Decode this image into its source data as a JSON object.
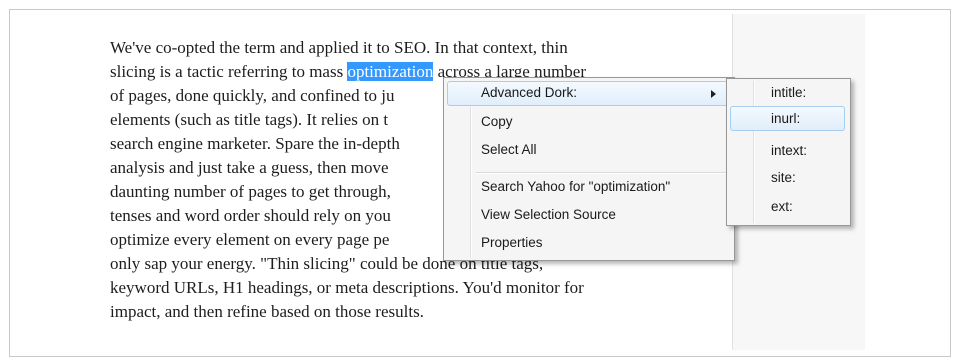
{
  "article": {
    "lines": [
      "We've co-opted the term and applied it to SEO. In that context, thin",
      "search engine marketer. Spare the in-depth",
      "analysis and just take a guess, then move",
      "daunting number of pages to get through,",
      "tenses and word order should rely on you",
      "optimize every element on every page pe",
      "only sap your energy. \"Thin slicing\" could be done on title tags,",
      "keyword URLs, H1 headings, or meta descriptions. You'd monitor for",
      "impact, and then refine based on those results."
    ],
    "line2": {
      "before": "slicing is a tactic referring to mass ",
      "selected": "optimization",
      "after": " across a large number"
    },
    "line3": "of pages, done quickly, and confined to ju",
    "line4": "elements (such as title tags). It relies on t"
  },
  "context_menu": {
    "advanced_dork": "Advanced Dork:",
    "copy": "Copy",
    "select_all": "Select All",
    "search_yahoo": "Search Yahoo for \"optimization\"",
    "view_selection_source": "View Selection Source",
    "properties": "Properties"
  },
  "submenu": {
    "items": [
      "intitle:",
      "inurl:",
      "intext:",
      "site:",
      "ext:"
    ]
  }
}
